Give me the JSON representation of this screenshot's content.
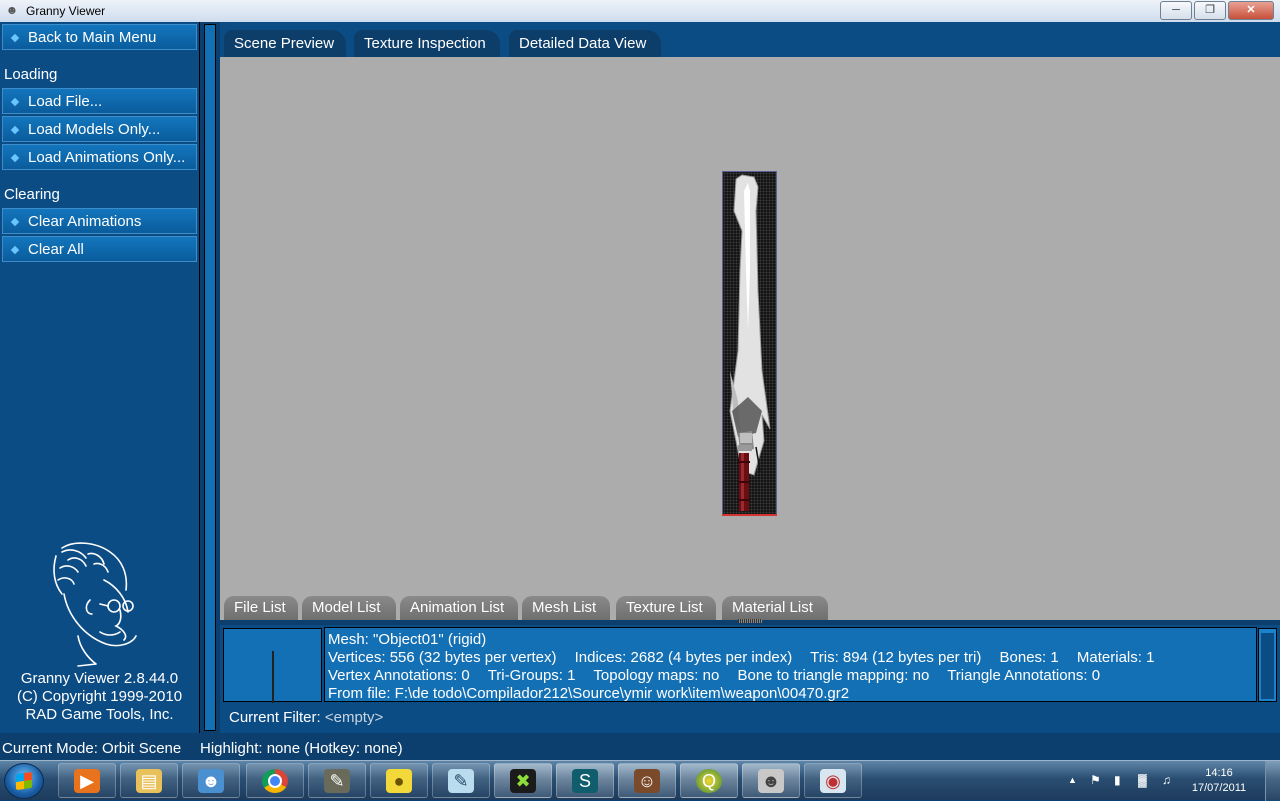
{
  "window": {
    "title": "Granny Viewer"
  },
  "sidebar": {
    "back": "Back to Main Menu",
    "loading_header": "Loading",
    "loading_items": [
      "Load File...",
      "Load Models Only...",
      "Load Animations Only..."
    ],
    "clearing_header": "Clearing",
    "clearing_items": [
      "Clear Animations",
      "Clear All"
    ],
    "credits": [
      "Granny Viewer 2.8.44.0",
      "(C) Copyright 1999-2010",
      "RAD Game Tools, Inc."
    ]
  },
  "top_tabs": [
    "Scene Preview",
    "Texture Inspection",
    "Detailed Data View"
  ],
  "bottom_tabs": [
    "File List",
    "Model List",
    "Animation List",
    "Mesh List",
    "Texture List",
    "Material List"
  ],
  "info": {
    "mesh": "Mesh: \"Object01\" (rigid)",
    "vertices": "Vertices: 556 (32 bytes per vertex)",
    "indices": "Indices: 2682 (4 bytes per index)",
    "tris": "Tris: 894 (12 bytes per tri)",
    "bones": "Bones: 1",
    "materials": "Materials: 1",
    "vertex_annotations": "Vertex Annotations: 0",
    "tri_groups": "Tri-Groups: 1",
    "topology_maps": "Topology maps: no",
    "bone_triangle": "Bone to triangle mapping: no",
    "triangle_annotations": "Triangle Annotations: 0",
    "from_file": "From file: F:\\de todo\\Compilador212\\Source\\ymir work\\item\\weapon\\00470.gr2"
  },
  "filter": {
    "label": "Current Filter:",
    "value": "<empty>"
  },
  "status": {
    "mode": "Current Mode: Orbit Scene",
    "highlight": "Highlight: none (Hotkey: none)"
  },
  "taskbar": {
    "apps": [
      "media-player-icon",
      "file-explorer-icon",
      "messenger-icon",
      "chrome-icon",
      "gimp-icon",
      "duck-icon",
      "notepad-icon",
      "xara-icon",
      "3ds-max-icon",
      "game-character-icon",
      "globe-icon",
      "granny-viewer-icon",
      "paint-icon"
    ],
    "clock_time": "14:16",
    "clock_date": "17/07/2011"
  }
}
